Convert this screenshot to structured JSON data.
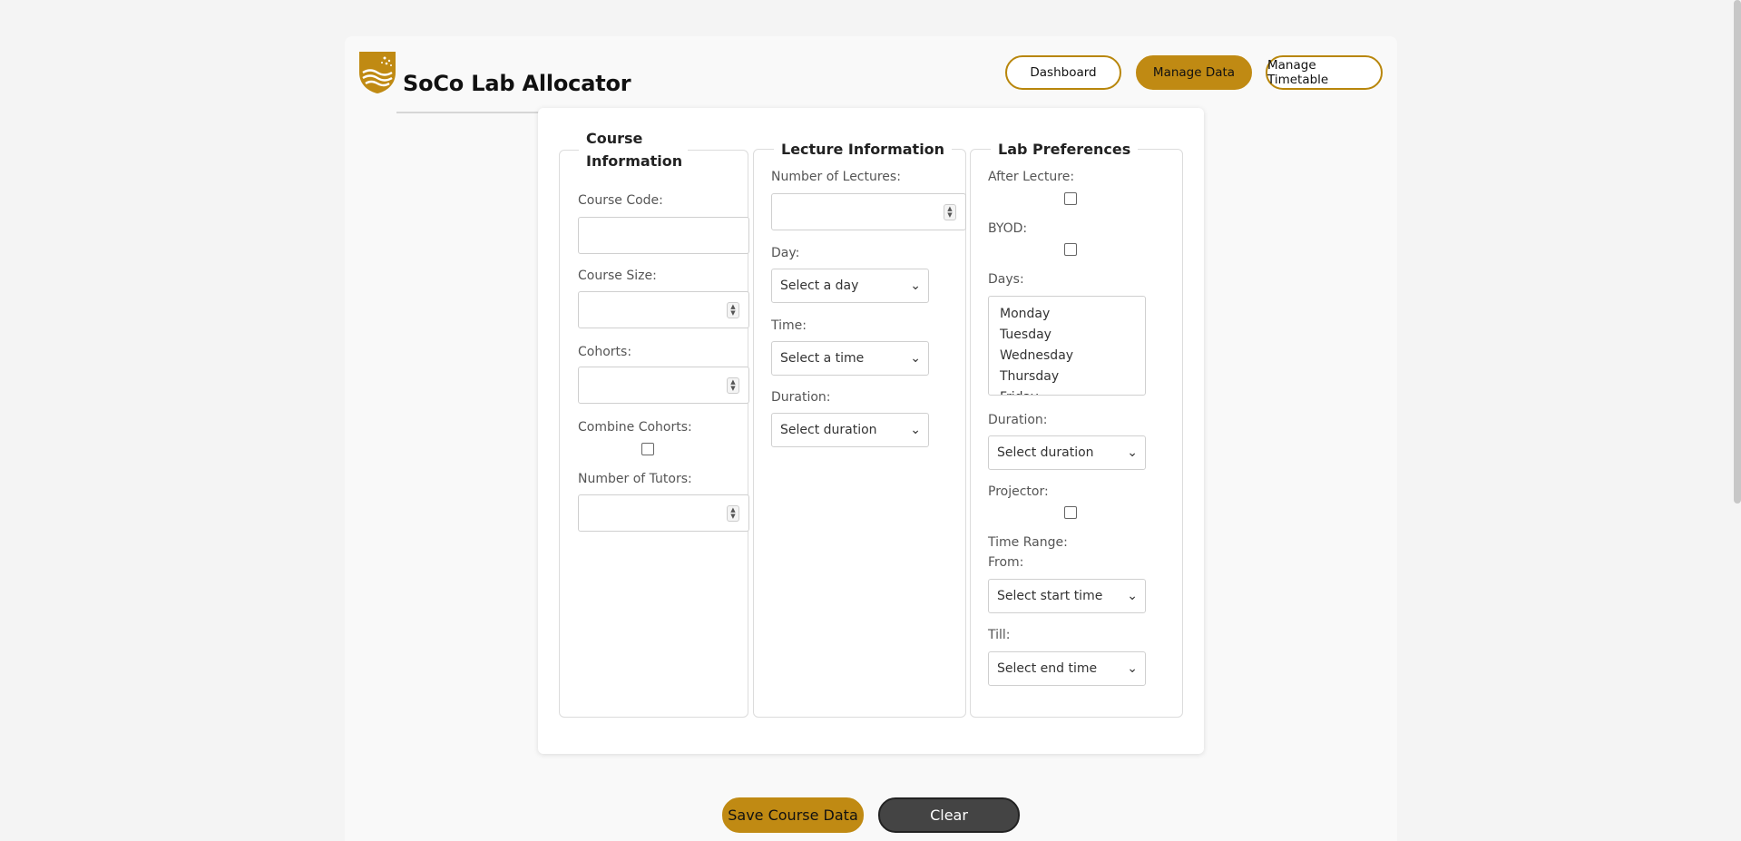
{
  "app": {
    "title": "SoCo Lab Allocator"
  },
  "nav": {
    "dashboard": "Dashboard",
    "manage_data": "Manage Data",
    "manage_timetable": "Manage Timetable"
  },
  "course_info": {
    "legend": "Course Information",
    "course_code_label": "Course Code:",
    "course_code_value": "",
    "course_size_label": "Course Size:",
    "course_size_value": "",
    "cohorts_label": "Cohorts:",
    "cohorts_value": "",
    "combine_cohorts_label": "Combine Cohorts:",
    "combine_cohorts_checked": false,
    "tutors_label": "Number of Tutors:",
    "tutors_value": ""
  },
  "lecture_info": {
    "legend": "Lecture Information",
    "num_lectures_label": "Number of Lectures:",
    "num_lectures_value": "",
    "day_label": "Day:",
    "day_selected": "Select a day",
    "time_label": "Time:",
    "time_selected": "Select a time",
    "duration_label": "Duration:",
    "duration_selected": "Select duration"
  },
  "lab_prefs": {
    "legend": "Lab Preferences",
    "after_lecture_label": "After Lecture:",
    "after_lecture_checked": false,
    "byod_label": "BYOD:",
    "byod_checked": false,
    "days_label": "Days:",
    "days_options": [
      "Monday",
      "Tuesday",
      "Wednesday",
      "Thursday",
      "Friday"
    ],
    "duration_label": "Duration:",
    "duration_selected": "Select duration",
    "projector_label": "Projector:",
    "projector_checked": false,
    "time_range_label": "Time Range:",
    "from_label": "From:",
    "from_selected": "Select start time",
    "till_label": "Till:",
    "till_selected": "Select end time"
  },
  "actions": {
    "save": "Save Course Data",
    "clear": "Clear"
  },
  "colors": {
    "accent": "#c08a13",
    "clear_button": "#444444"
  }
}
